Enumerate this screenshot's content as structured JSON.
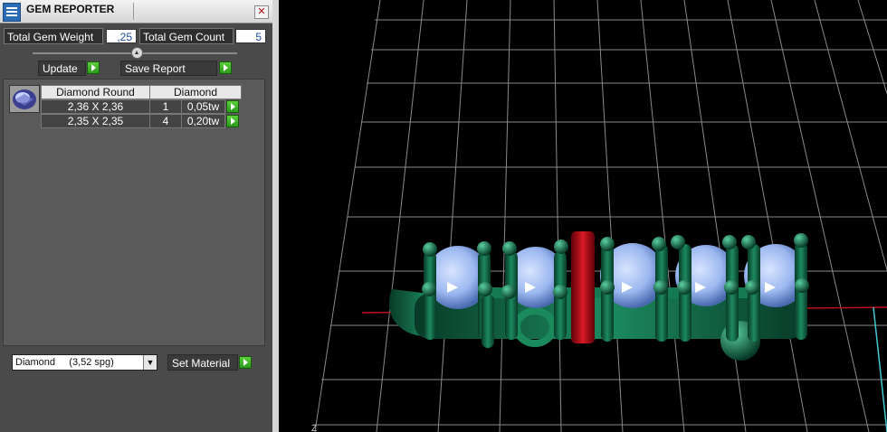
{
  "panel": {
    "title": "GEM REPORTER",
    "close_label": "✕",
    "weight_label": "Total Gem Weight",
    "weight_value": ",25",
    "count_label": "Total Gem Count",
    "count_value": "5",
    "update_label": "Update",
    "save_label": "Save Report"
  },
  "table": {
    "headers": [
      "Diamond Round",
      "Diamond"
    ],
    "rows": [
      {
        "size": "2,36 X 2,36",
        "qty": "1",
        "weight": "0,05tw"
      },
      {
        "size": "2,35 X 2,35",
        "qty": "4",
        "weight": "0,20tw"
      }
    ]
  },
  "material": {
    "selected": "Diamond     (3,52 spg)",
    "set_label": "Set Material"
  },
  "viewport": {
    "axis_label": "Z"
  },
  "colors": {
    "metal": "#0f5a3e",
    "gem": "#9cb8f0",
    "prong_red": "#c0101a",
    "grid": "#8a8a8a",
    "accent_button": "#3fb82a"
  }
}
